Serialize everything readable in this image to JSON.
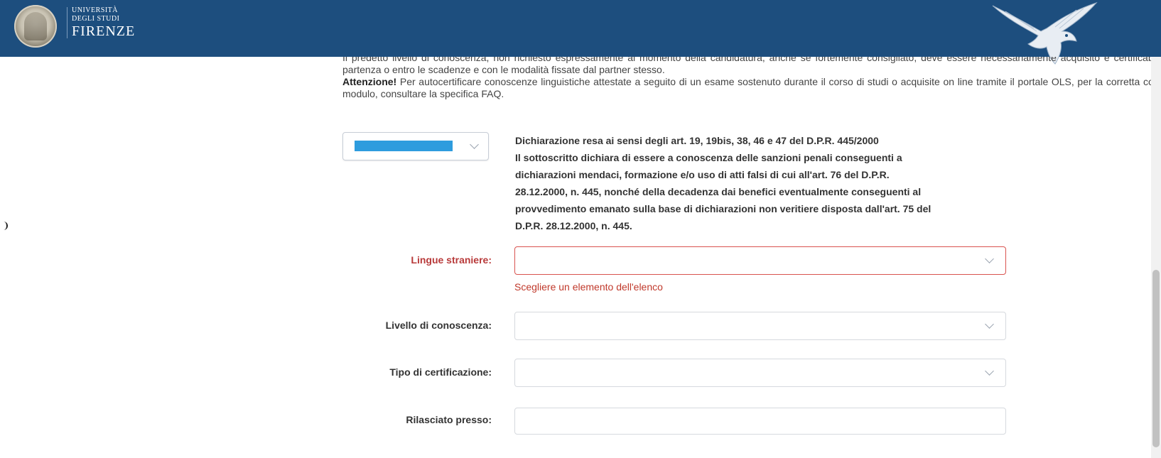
{
  "header": {
    "university_line1": "UNIVERSITÀ",
    "university_line2": "DEGLI STUDI",
    "university_line3": "FIRENZE"
  },
  "intro": {
    "paragraph": "Il predetto livello di conoscenza, non richiesto espressamente al momento della candidatura, anche se fortemente consigliato, deve essere necessariamente acquisito e certificabile prima della partenza o entro le scadenze e con le modalità fissate dal partner stesso.",
    "warning_title": "Attenzione!",
    "warning_text": " Per autocertificare conoscenze linguistiche attestate a seguito di un esame sostenuto durante il corso di studi o acquisite on line tramite il portale OLS, per la corretta compilazione del modulo, consultare la specifica FAQ."
  },
  "declaration": {
    "line1": "Dichiarazione resa ai sensi degli art. 19, 19bis, 38, 46 e 47 del D.P.R. 445/2000",
    "text": "Il sottoscritto dichiara di essere a conoscenza delle sanzioni penali conseguenti a dichiarazioni mendaci, formazione e/o uso di atti falsi di cui all'art. 76 del D.P.R. 28.12.2000, n. 445, nonché della decadenza dai benefici eventualmente conseguenti al provvedimento emanato sulla base di dichiarazioni non veritiere disposta dall'art. 75 del D.P.R. 28.12.2000, n. 445."
  },
  "form": {
    "lingue_label": "Lingue straniere:",
    "lingue_value": "",
    "lingue_error": "Scegliere un elemento dell'elenco",
    "livello_label": "Livello di conoscenza:",
    "livello_value": "",
    "tipo_label": "Tipo di certificazione:",
    "tipo_value": "",
    "rilasciato_label": "Rilasciato presso:",
    "rilasciato_value": ""
  },
  "colors": {
    "header_bg": "#1d4e7e",
    "error": "#c0392b",
    "selection_bar": "#2e9cde"
  },
  "icons": [
    "university-seal-icon",
    "eagle-logo-icon",
    "chevron-down-icon"
  ]
}
